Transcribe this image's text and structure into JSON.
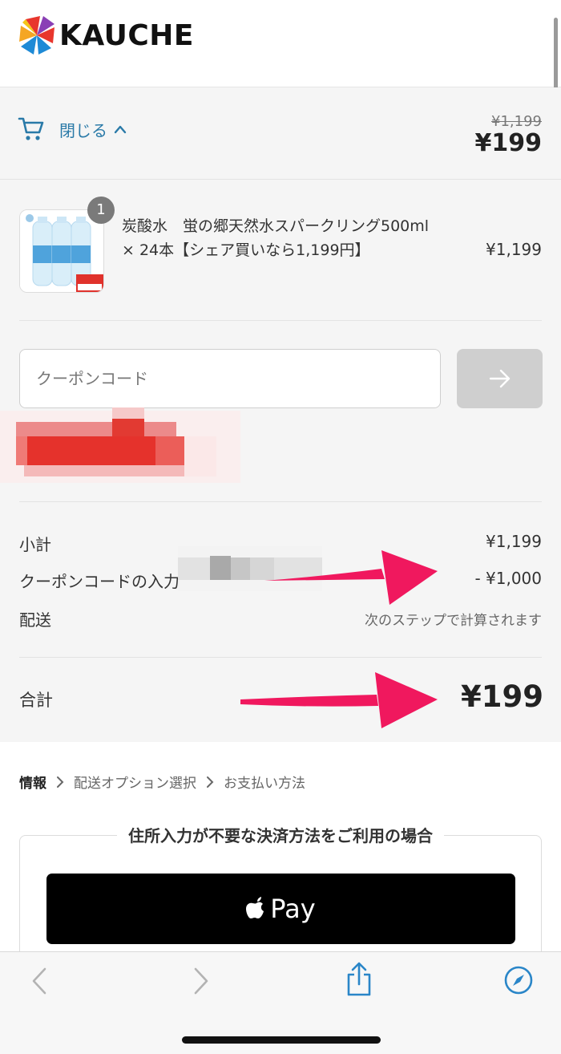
{
  "header": {
    "brand": "KAUCHE",
    "logo_icon": "kauche-logo-icon"
  },
  "order_summary": {
    "toggle_label": "閉じる",
    "original_price": "¥1,199",
    "total_price": "¥199"
  },
  "product": {
    "quantity_badge": "1",
    "name": "炭酸水　蛍の郷天然水スパークリング500ml × 24本【シェア買いなら1,199円】",
    "price": "¥1,199",
    "thumbnail_icon": "sparkling-water-bottles-image"
  },
  "coupon": {
    "placeholder": "クーポンコード",
    "apply_icon": "arrow-right-icon"
  },
  "breakdown": {
    "subtotal_label": "小計",
    "subtotal_value": "¥1,199",
    "coupon_label": "クーポンコードの入力",
    "coupon_value": "- ¥1,000",
    "shipping_label": "配送",
    "shipping_value": "次のステップで計算されます"
  },
  "total": {
    "label": "合計",
    "value": "¥199"
  },
  "breadcrumb": [
    "情報",
    "配送オプション選択",
    "お支払い方法"
  ],
  "express_checkout": {
    "title": "住所入力が不要な決済方法をご利用の場合",
    "apple_pay_label": "Pay"
  },
  "colors": {
    "link": "#2a7aa8",
    "annotation_arrow": "#f0185e",
    "button_disabled": "#cfcfcf",
    "apple_pay": "#000000"
  }
}
